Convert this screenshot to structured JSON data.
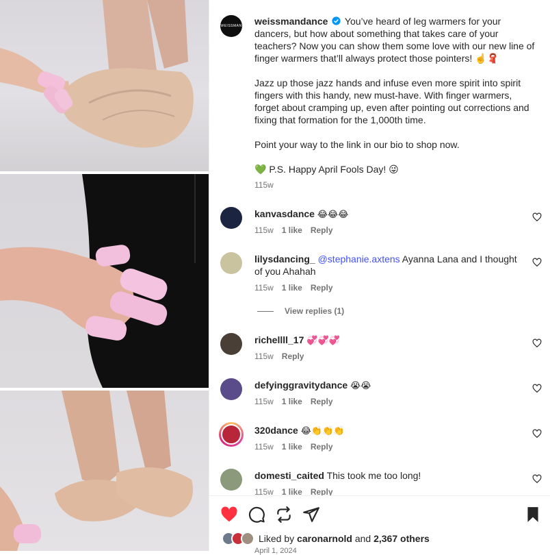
{
  "post": {
    "author": "weissmandance",
    "author_avatar_text": "WEISSMAN",
    "caption_p1": "You’ve heard of leg warmers for your dancers, but how about something that takes care of your teachers? Now you can show them some love with our new line of finger warmers that’ll always protect those pointers! ☝️🧣",
    "caption_p2": "Jazz up those jazz hands and infuse even more spirit into spirit fingers with this handy, new must-have. With finger warmers, forget about cramping up, even after pointing out corrections and fixing that formation for the 1,000th time.",
    "caption_p3": "Point your way to the link in our bio to shop now.",
    "caption_p4": "💚 P.S. Happy April Fools Day! 😜",
    "age": "115w",
    "verified_icon": "verified-badge-icon"
  },
  "comments": [
    {
      "user": "kanvasdance",
      "text": "😂😂😂",
      "age": "115w",
      "likes": "1 like",
      "reply": "Reply",
      "avatar_color": "#1b2440"
    },
    {
      "user": "lilysdancing_",
      "mention": "@stephanie.axtens",
      "text": "Ayanna Lana and I thought of you Ahahah",
      "age": "115w",
      "likes": "1 like",
      "reply": "Reply",
      "view_replies": "View replies (1)",
      "avatar_color": "#c9c3a0"
    },
    {
      "user": "richellll_17",
      "text": "💞💞💞",
      "age": "115w",
      "reply": "Reply",
      "avatar_color": "#4a3f36"
    },
    {
      "user": "defyinggravitydance",
      "text": "😭😭",
      "age": "115w",
      "likes": "1 like",
      "reply": "Reply",
      "avatar_color": "#5a4c8a"
    },
    {
      "user": "320dance",
      "text": "😂👏👏👏",
      "age": "115w",
      "likes": "1 like",
      "reply": "Reply",
      "avatar_color": "#b8263a"
    },
    {
      "user": "domesti_caited",
      "text": "This took me too long!",
      "age": "115w",
      "likes": "1 like",
      "reply": "Reply",
      "avatar_color": "#8a9a7a"
    }
  ],
  "actions": {
    "like_icon": "heart-filled-icon",
    "comment_icon": "comment-icon",
    "share_icon": "repost-icon",
    "send_icon": "send-icon",
    "save_icon": "bookmark-icon",
    "like_color": "#ff3040"
  },
  "likes_summary": {
    "prefix": "Liked by",
    "user": "caronarnold",
    "and": "and",
    "others": "2,367 others"
  },
  "date": "April 1, 2024"
}
